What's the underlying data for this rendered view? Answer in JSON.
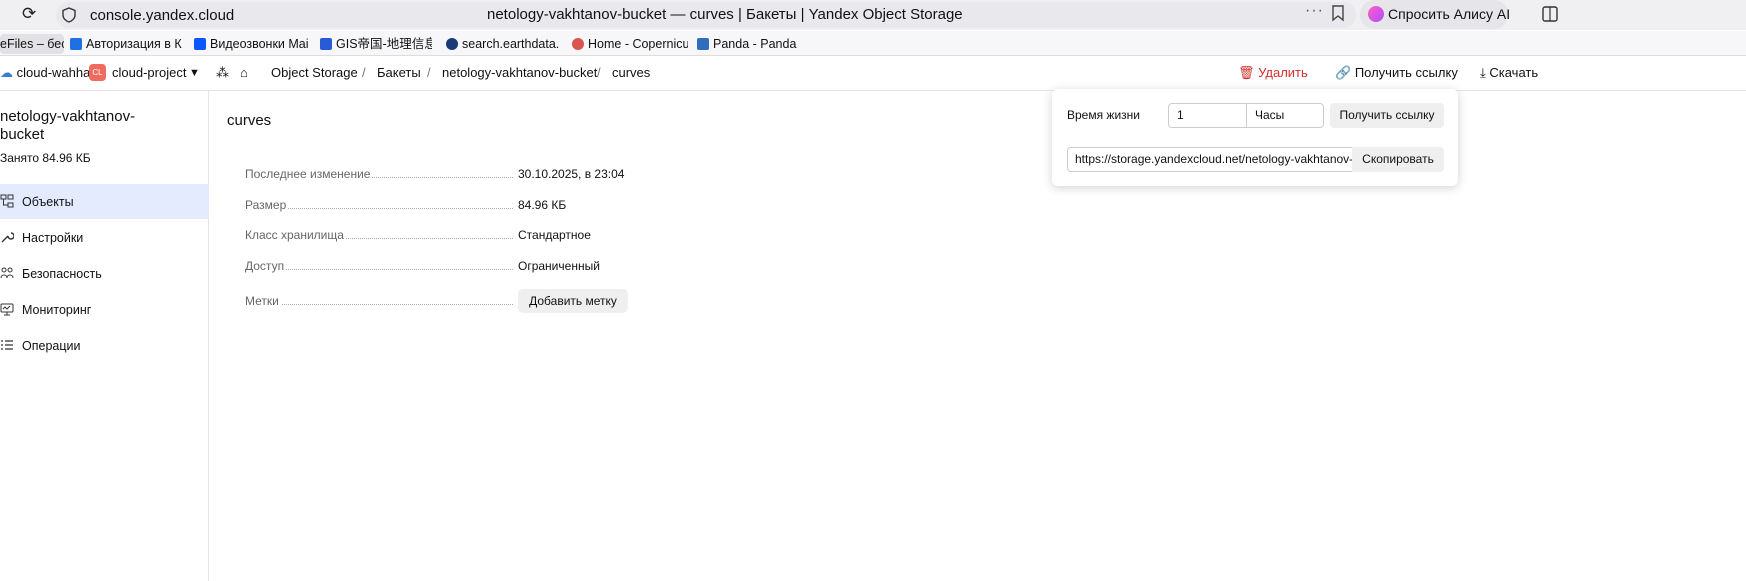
{
  "browser": {
    "url": "console.yandex.cloud",
    "tab_title": "netology-vakhtanov-bucket — curves | Бакеты | Yandex Object Storage",
    "more_dots": "···",
    "alice_label": "Спросить Алису AI"
  },
  "bookmarks": [
    {
      "label": "eFiles – бес",
      "color": "#3a7bd5"
    },
    {
      "label": "Авторизация в КП",
      "color": "#1f6fe5"
    },
    {
      "label": "Видеозвонки Mail",
      "color": "#0b57ff"
    },
    {
      "label": "GIS帝国-地理信息",
      "color": "#2a5bd7"
    },
    {
      "label": "search.earthdata.n",
      "color": "#1b3a7a"
    },
    {
      "label": "Home - Copernicus",
      "color": "#d9534f"
    },
    {
      "label": "Panda - Panda",
      "color": "#2f6dbf"
    }
  ],
  "console": {
    "cloud": "cloud-wahha",
    "project_badge": "CL",
    "project": "cloud-project",
    "breadcrumbs": [
      "Object Storage",
      "Бакеты",
      "netology-vakhtanov-bucket",
      "curves"
    ],
    "breadcrumb_sep": "/",
    "delete_label": "Удалить",
    "get_link_label": "Получить ссылку",
    "download_label": "Скачать"
  },
  "sidebar": {
    "bucket_name": "netology-vakhtanov-bucket",
    "used": "Занято 84.96 КБ",
    "items": [
      {
        "label": "Объекты",
        "icon": "objects-icon",
        "active": true
      },
      {
        "label": "Настройки",
        "icon": "wrench-icon",
        "active": false
      },
      {
        "label": "Безопасность",
        "icon": "users-icon",
        "active": false
      },
      {
        "label": "Мониторинг",
        "icon": "monitor-icon",
        "active": false
      },
      {
        "label": "Операции",
        "icon": "list-icon",
        "active": false
      }
    ]
  },
  "object": {
    "title": "curves",
    "rows": [
      {
        "label": "Последнее изменение",
        "value": "30.10.2025, в 23:04"
      },
      {
        "label": "Размер",
        "value": "84.96 КБ"
      },
      {
        "label": "Класс хранилища",
        "value": "Стандартное"
      },
      {
        "label": "Доступ",
        "value": "Ограниченный"
      }
    ],
    "tags_label": "Метки",
    "add_tag_label": "Добавить метку"
  },
  "popup": {
    "ttl_label": "Время жизни",
    "ttl_value": "1",
    "ttl_unit": "Часы",
    "get_link_label": "Получить ссылку",
    "link_value": "https://storage.yandexcloud.net/netology-vakhtanov-bucket/curves",
    "copy_label": "Скопировать"
  },
  "colors": {
    "accent_bg": "#e5ebff",
    "danger": "#d32f2f",
    "project_badge": "#ef6b5e"
  }
}
